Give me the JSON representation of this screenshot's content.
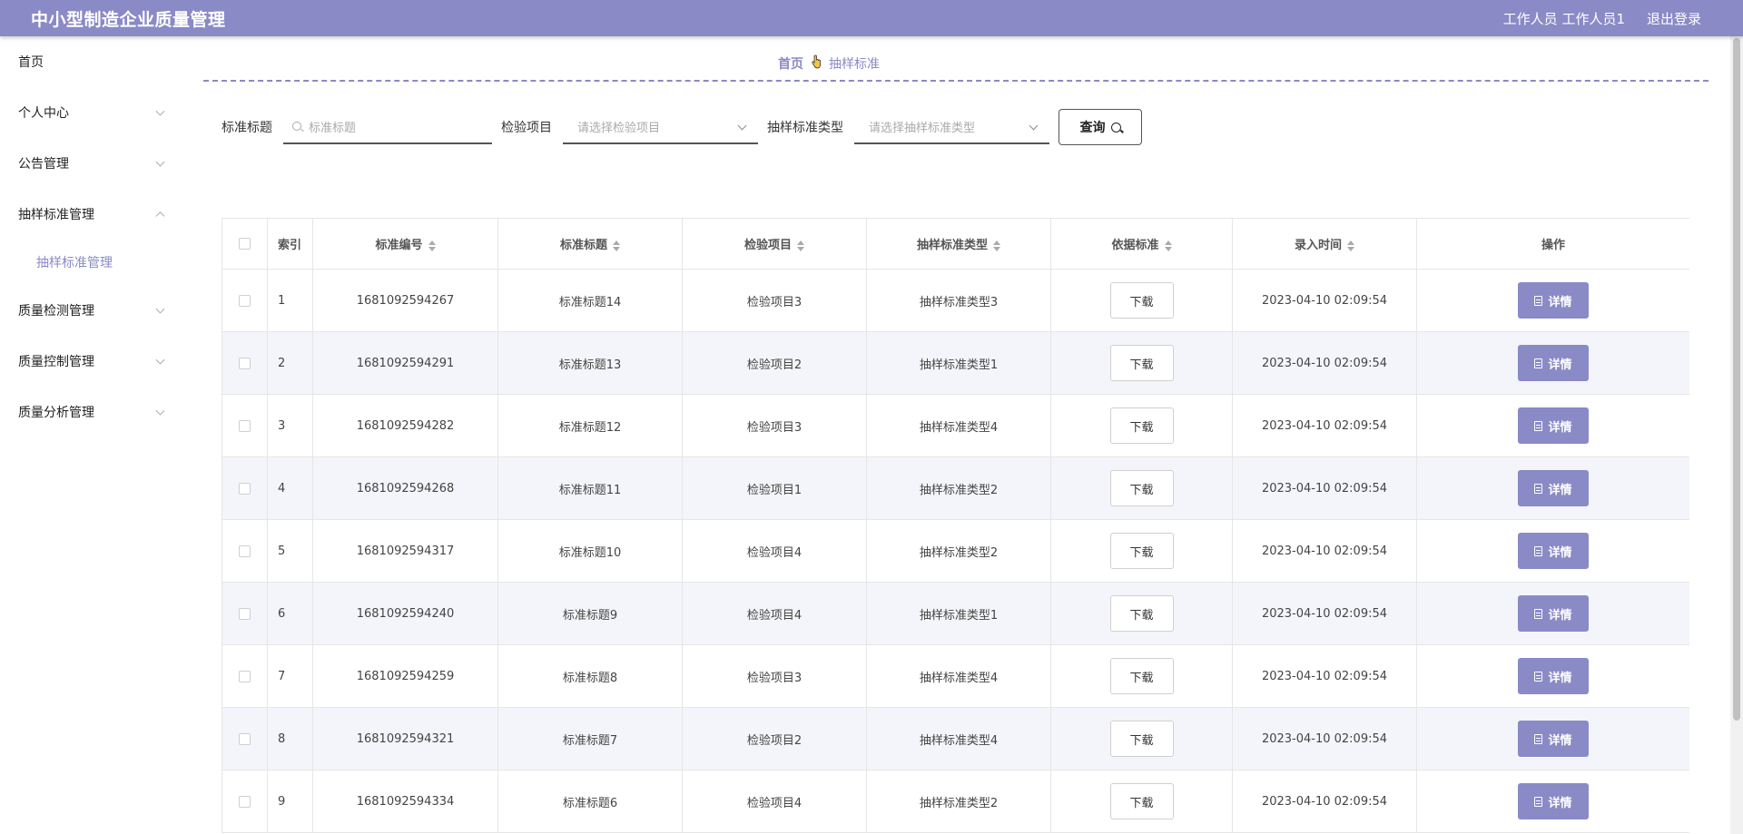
{
  "header": {
    "app_title": "中小型制造企业质量管理",
    "user_label": "工作人员 工作人员1",
    "logout_label": "退出登录"
  },
  "sidebar": {
    "items": [
      {
        "label": "首页"
      },
      {
        "label": "个人中心"
      },
      {
        "label": "公告管理"
      },
      {
        "label": "抽样标准管理"
      },
      {
        "label": "抽样标准管理"
      },
      {
        "label": "质量检测管理"
      },
      {
        "label": "质量控制管理"
      },
      {
        "label": "质量分析管理"
      }
    ]
  },
  "breadcrumb": {
    "home": "首页",
    "current": "抽样标准"
  },
  "search": {
    "title_label": "标准标题",
    "title_placeholder": "标准标题",
    "item_label": "检验项目",
    "item_placeholder": "请选择检验项目",
    "type_label": "抽样标准类型",
    "type_placeholder": "请选择抽样标准类型",
    "query_label": "查询"
  },
  "table": {
    "headers": [
      "索引",
      "标准编号",
      "标准标题",
      "检验项目",
      "抽样标准类型",
      "依据标准",
      "录入时间",
      "操作"
    ],
    "download_label": "下载",
    "detail_label": "详情",
    "rows": [
      {
        "index": "1",
        "code": "1681092594267",
        "title": "标准标题14",
        "item": "检验项目3",
        "type": "抽样标准类型3",
        "time": "2023-04-10 02:09:54"
      },
      {
        "index": "2",
        "code": "1681092594291",
        "title": "标准标题13",
        "item": "检验项目2",
        "type": "抽样标准类型1",
        "time": "2023-04-10 02:09:54"
      },
      {
        "index": "3",
        "code": "1681092594282",
        "title": "标准标题12",
        "item": "检验项目3",
        "type": "抽样标准类型4",
        "time": "2023-04-10 02:09:54"
      },
      {
        "index": "4",
        "code": "1681092594268",
        "title": "标准标题11",
        "item": "检验项目1",
        "type": "抽样标准类型2",
        "time": "2023-04-10 02:09:54"
      },
      {
        "index": "5",
        "code": "1681092594317",
        "title": "标准标题10",
        "item": "检验项目4",
        "type": "抽样标准类型2",
        "time": "2023-04-10 02:09:54"
      },
      {
        "index": "6",
        "code": "1681092594240",
        "title": "标准标题9",
        "item": "检验项目4",
        "type": "抽样标准类型1",
        "time": "2023-04-10 02:09:54"
      },
      {
        "index": "7",
        "code": "1681092594259",
        "title": "标准标题8",
        "item": "检验项目3",
        "type": "抽样标准类型4",
        "time": "2023-04-10 02:09:54"
      },
      {
        "index": "8",
        "code": "1681092594321",
        "title": "标准标题7",
        "item": "检验项目2",
        "type": "抽样标准类型4",
        "time": "2023-04-10 02:09:54"
      },
      {
        "index": "9",
        "code": "1681092594334",
        "title": "标准标题6",
        "item": "检验项目4",
        "type": "抽样标准类型2",
        "time": "2023-04-10 02:09:54"
      }
    ]
  },
  "colors": {
    "accent": "#8a8ac6",
    "row_stripe": "#f4f5fa"
  }
}
